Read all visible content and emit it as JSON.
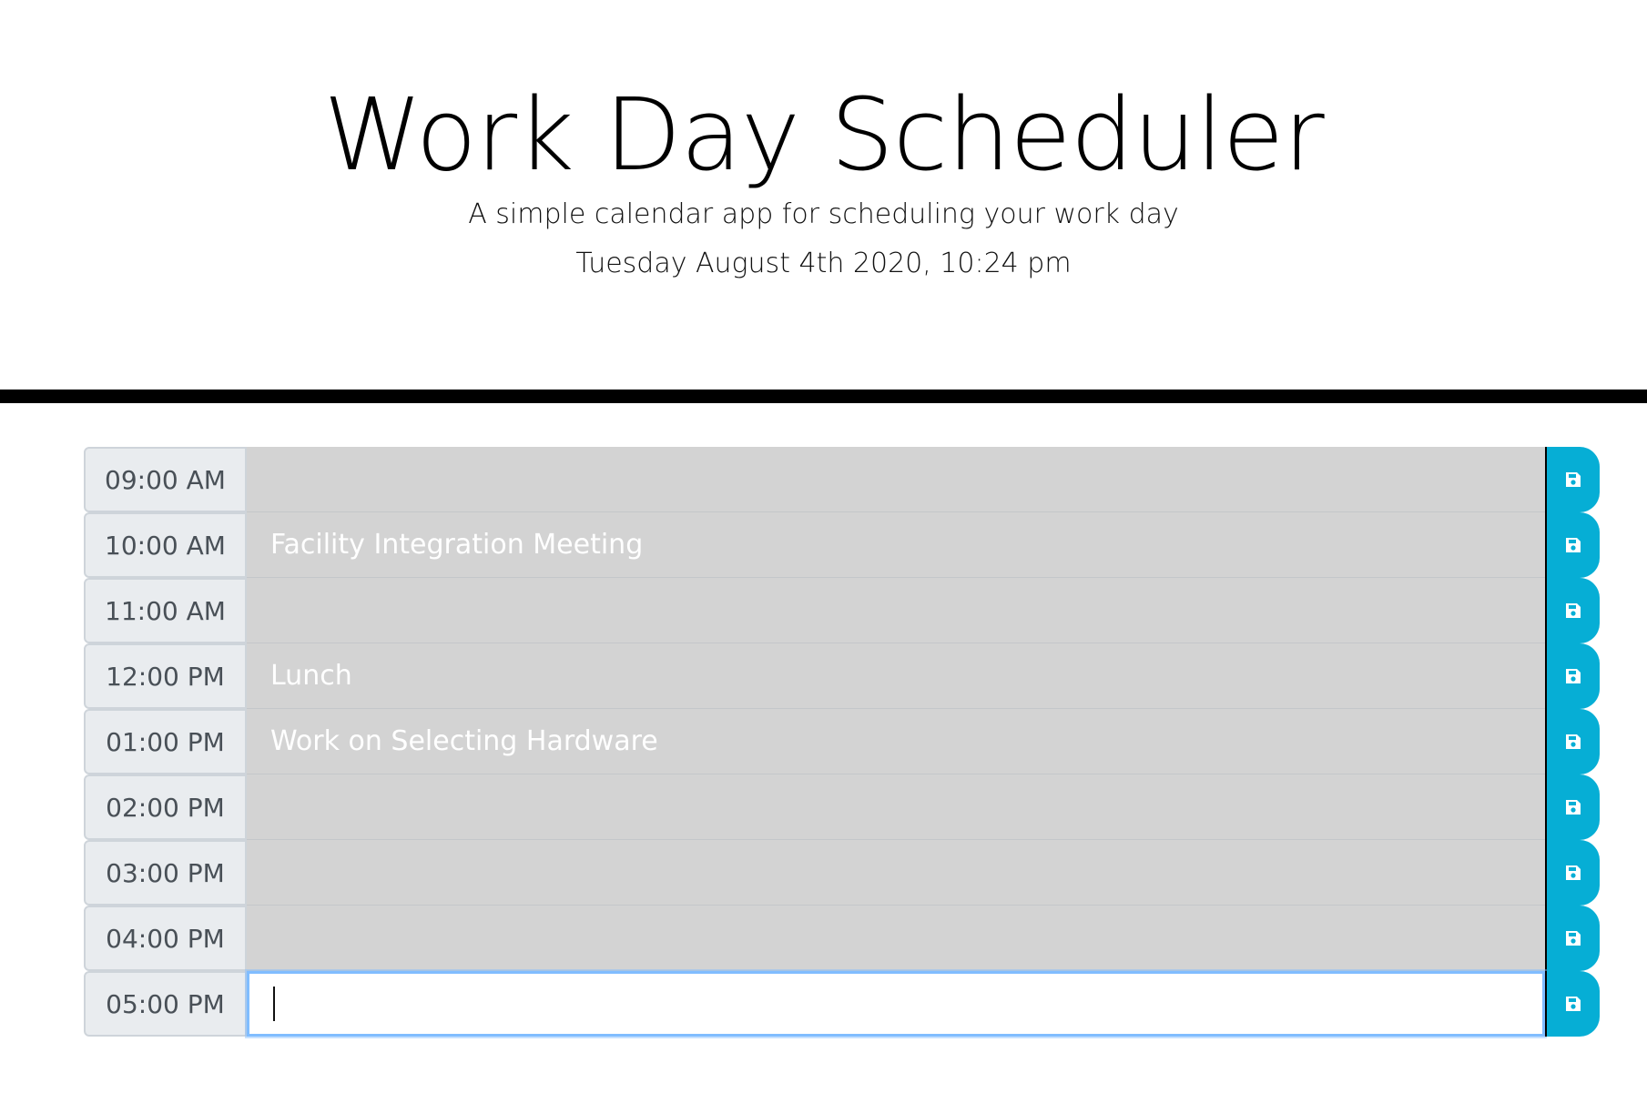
{
  "header": {
    "title": "Work Day Scheduler",
    "subtitle": "A simple calendar app for scheduling your work day",
    "current_datetime": "Tuesday August 4th 2020, 10:24 pm"
  },
  "colors": {
    "past": "#d3d3d3",
    "present": "#ffffff",
    "save_button": "#06aed5",
    "hour_label_bg": "#e9ecef"
  },
  "time_blocks": [
    {
      "hour": "09:00 AM",
      "description": "",
      "state": "past",
      "save_icon": "floppy-disk-icon"
    },
    {
      "hour": "10:00 AM",
      "description": "Facility Integration Meeting",
      "state": "past",
      "save_icon": "floppy-disk-icon"
    },
    {
      "hour": "11:00 AM",
      "description": "",
      "state": "past",
      "save_icon": "floppy-disk-icon"
    },
    {
      "hour": "12:00 PM",
      "description": "Lunch",
      "state": "past",
      "save_icon": "floppy-disk-icon"
    },
    {
      "hour": "01:00 PM",
      "description": "Work on Selecting Hardware",
      "state": "past",
      "save_icon": "floppy-disk-icon"
    },
    {
      "hour": "02:00 PM",
      "description": "",
      "state": "past",
      "save_icon": "floppy-disk-icon"
    },
    {
      "hour": "03:00 PM",
      "description": "",
      "state": "past",
      "save_icon": "floppy-disk-icon"
    },
    {
      "hour": "04:00 PM",
      "description": "",
      "state": "past",
      "save_icon": "floppy-disk-icon"
    },
    {
      "hour": "05:00 PM",
      "description": "",
      "state": "present",
      "save_icon": "floppy-disk-icon"
    }
  ]
}
